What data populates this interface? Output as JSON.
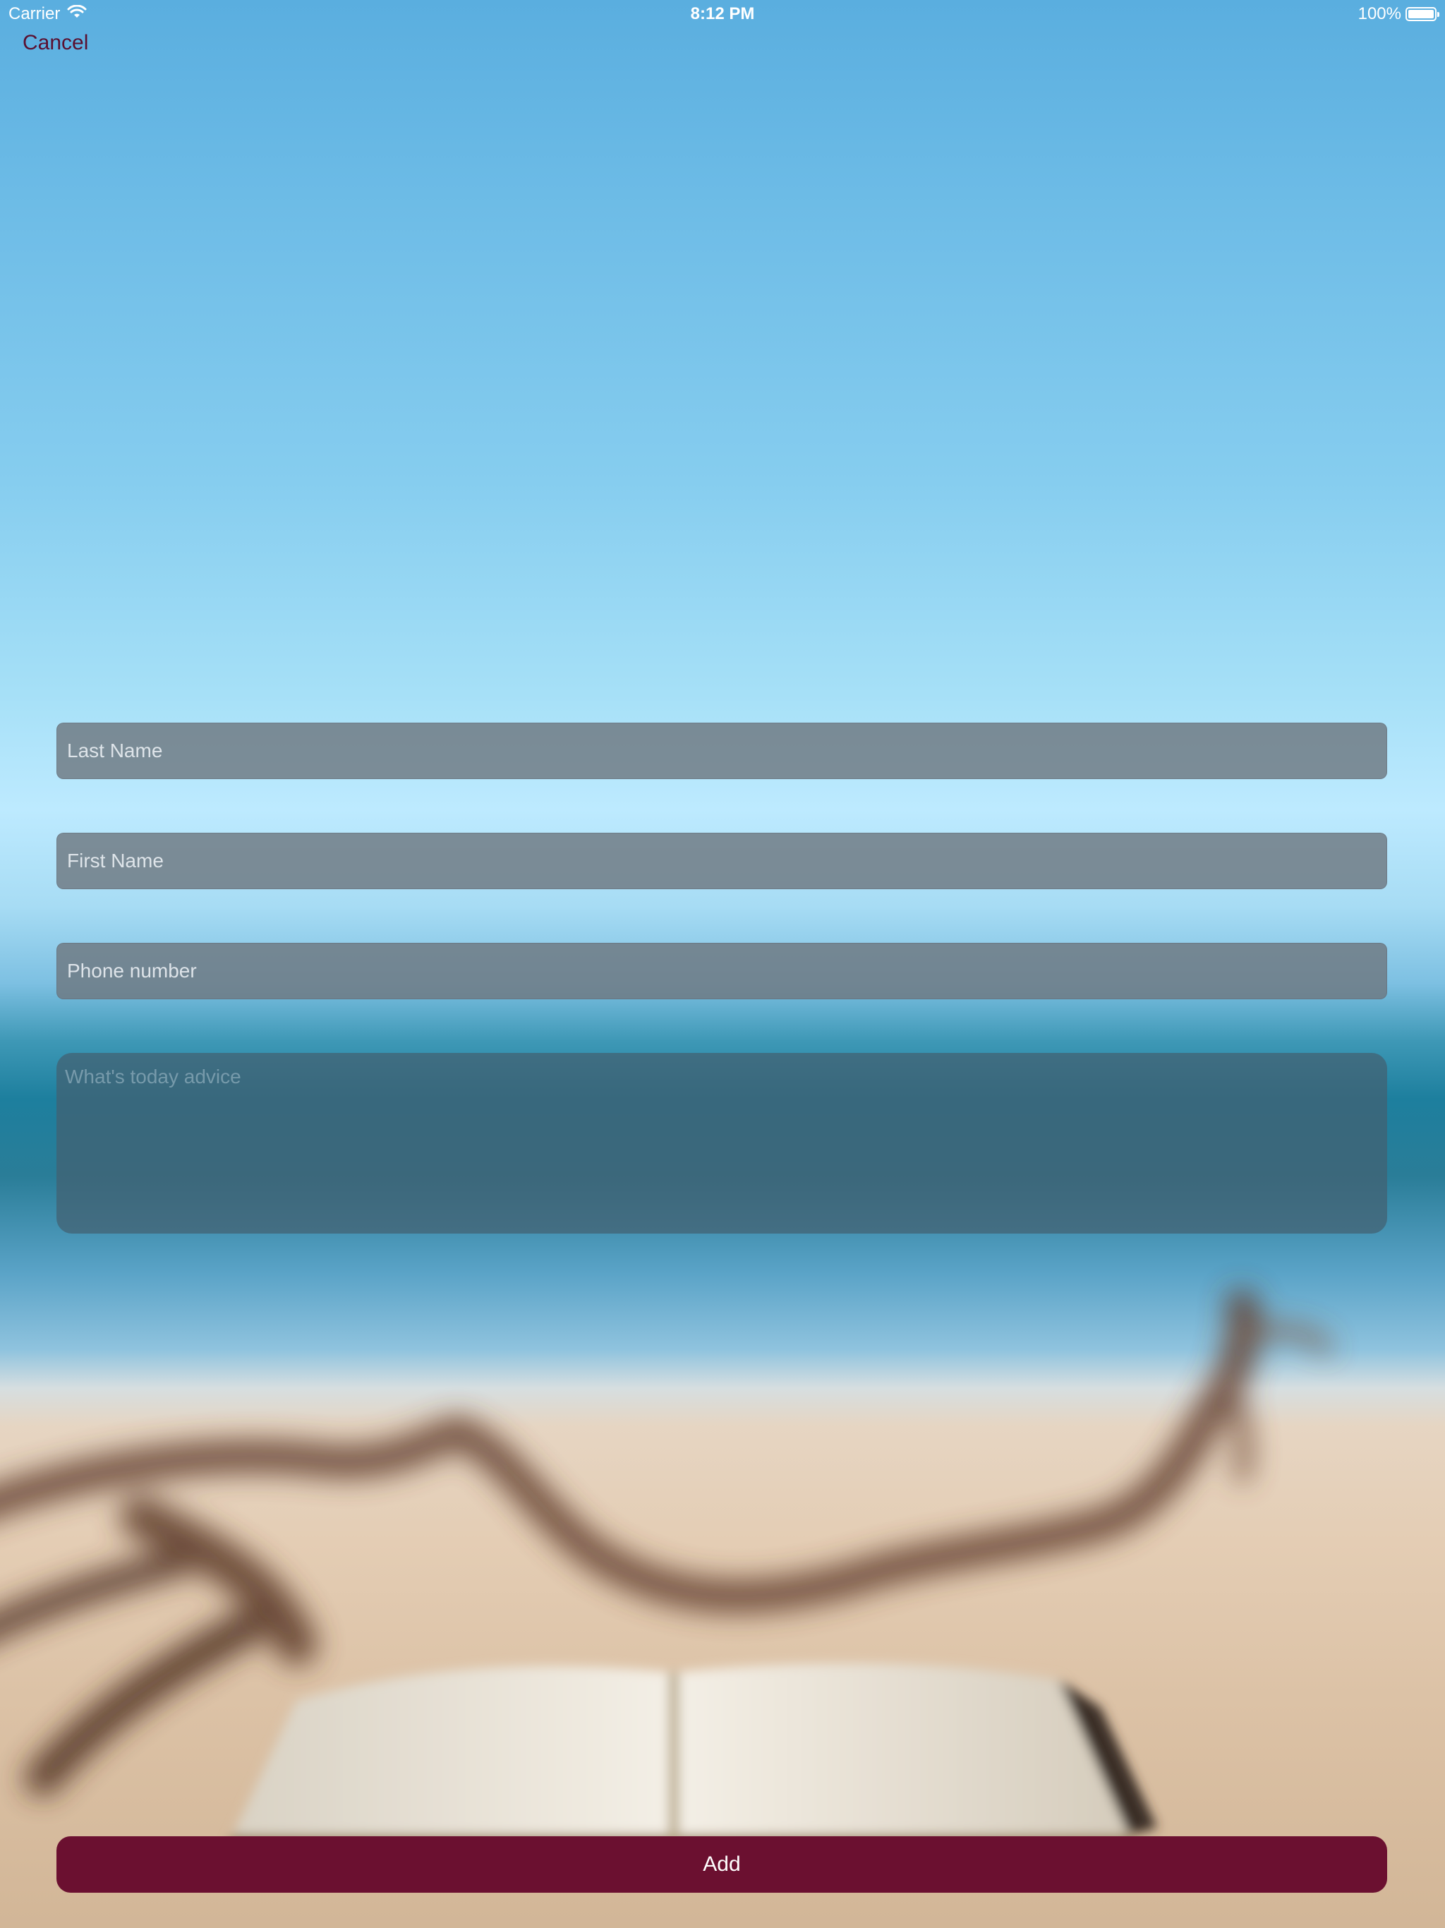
{
  "status_bar": {
    "carrier": "Carrier",
    "time": "8:12 PM",
    "battery": "100%",
    "wifi_icon": "wifi-icon",
    "battery_icon": "battery-icon"
  },
  "nav": {
    "cancel_label": "Cancel"
  },
  "form": {
    "last_name_placeholder": "Last Name",
    "first_name_placeholder": "First Name",
    "phone_placeholder": "Phone number",
    "advice_placeholder": "What's today advice",
    "add_label": "Add"
  },
  "colors": {
    "accent": "#6b1030",
    "field_background": "#6e7880",
    "cancel_text": "#5a1030"
  }
}
